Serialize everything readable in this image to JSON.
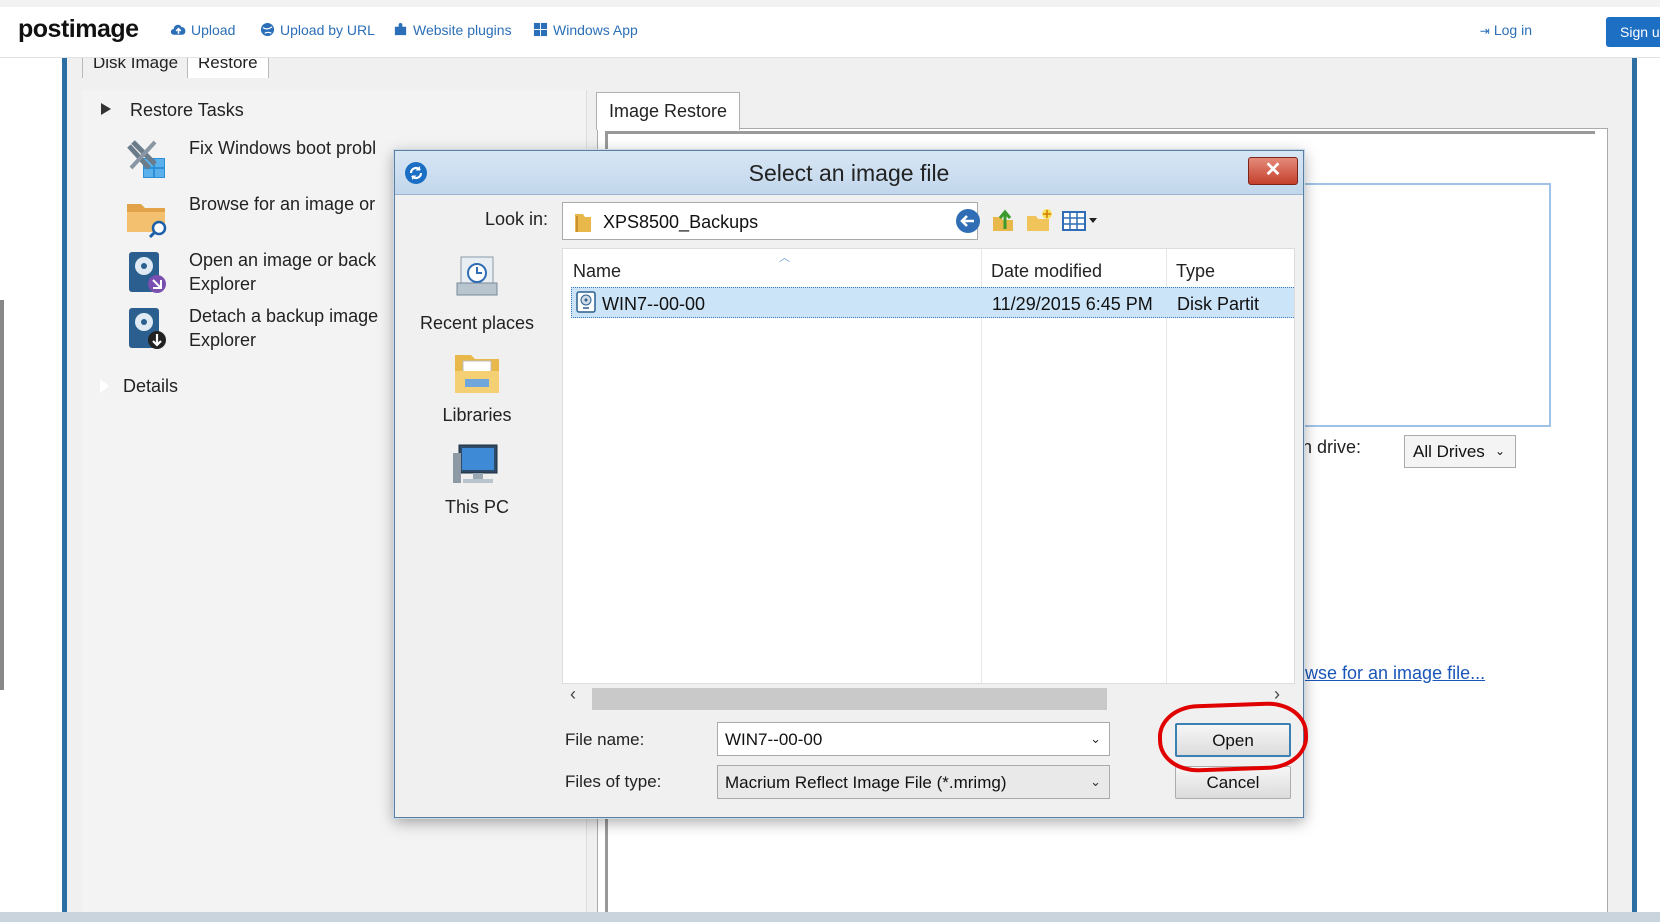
{
  "site": {
    "logo": "postimage",
    "nav": [
      "Upload",
      "Upload by URL",
      "Website plugins",
      "Windows App"
    ],
    "login": "Log in",
    "signup": "Sign up"
  },
  "app": {
    "tabs": [
      "Disk Image",
      "Restore"
    ],
    "tasks_header": "Restore Tasks",
    "tasks": [
      {
        "line1": "Fix Windows boot probl",
        "line2": ""
      },
      {
        "line1": "Browse for an image or",
        "line2": ""
      },
      {
        "line1": "Open an image or back",
        "line2": "Explorer"
      },
      {
        "line1": "Detach a backup image",
        "line2": "Explorer"
      }
    ],
    "details": "Details",
    "image_restore_tab": "Image Restore",
    "drive_label": "ain drive:",
    "drive_value": "All Drives",
    "browse_link": "owse for an image file..."
  },
  "dialog": {
    "title": "Select an image file",
    "close": "✕",
    "look_in_label": "Look in:",
    "look_in_value": "XPS8500_Backups",
    "places": [
      "Recent places",
      "Libraries",
      "This PC"
    ],
    "columns": [
      "Name",
      "Date modified",
      "Type"
    ],
    "files": [
      {
        "name": "WIN7--00-00",
        "date": "11/29/2015 6:45 PM",
        "type": "Disk Partit"
      }
    ],
    "file_name_label": "File name:",
    "file_name_value": "WIN7--00-00",
    "file_type_label": "Files of type:",
    "file_type_value": "Macrium Reflect Image File (*.mrimg)",
    "open": "Open",
    "cancel": "Cancel"
  },
  "colors": {
    "brand": "#1d6fc4",
    "selection": "#cce4f7",
    "annotation": "#e00000",
    "link": "#1a56b8"
  }
}
